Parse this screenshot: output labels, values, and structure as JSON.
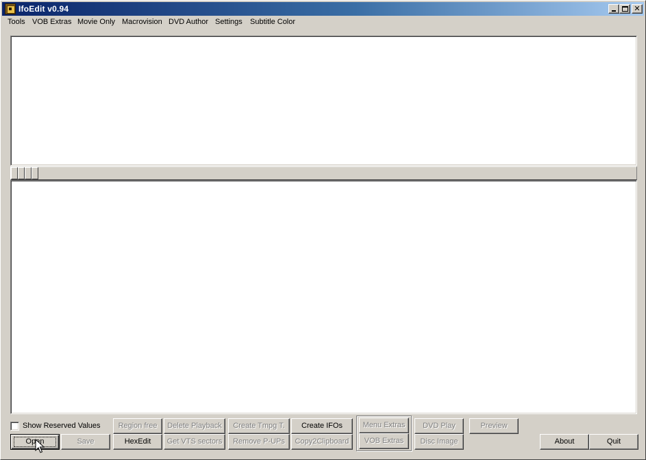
{
  "window": {
    "title": "IfoEdit v0.94",
    "controls": {
      "minimize": "_",
      "maximize": "□",
      "close": "✕"
    }
  },
  "menu": [
    {
      "label": "Tools"
    },
    {
      "label": "VOB Extras"
    },
    {
      "label": "Movie Only"
    },
    {
      "label": "Macrovision"
    },
    {
      "label": "DVD Author"
    },
    {
      "label": "Settings"
    },
    {
      "label": "Subtitle Color"
    }
  ],
  "options": {
    "show_reserved_label": "Show Reserved Values",
    "show_reserved_checked": false
  },
  "buttons": {
    "region_free": "Region free",
    "delete_playback": "Delete Playback",
    "create_tmpg": "Create Tmpg T.",
    "create_ifos": "Create IFOs",
    "menu_extras": "Menu Extras",
    "dvd_play": "DVD Play",
    "preview": "Preview",
    "open": "Open",
    "save": "Save",
    "hexedit": "HexEdit",
    "get_vts_sectors": "Get VTS sectors",
    "remove_pups": "Remove P-UPs",
    "copy2clipboard": "Copy2Clipboard",
    "vob_extras": "VOB Extras",
    "disc_image": "Disc Image",
    "about": "About",
    "quit": "Quit"
  },
  "colors": {
    "face": "#d4d0c8",
    "title_gradient_start": "#0a246a",
    "title_gradient_end": "#a6caf0",
    "disabled_text": "#808080"
  },
  "icons": {
    "app": "ifoedit-app-icon",
    "cursor": "arrow-cursor-icon"
  }
}
